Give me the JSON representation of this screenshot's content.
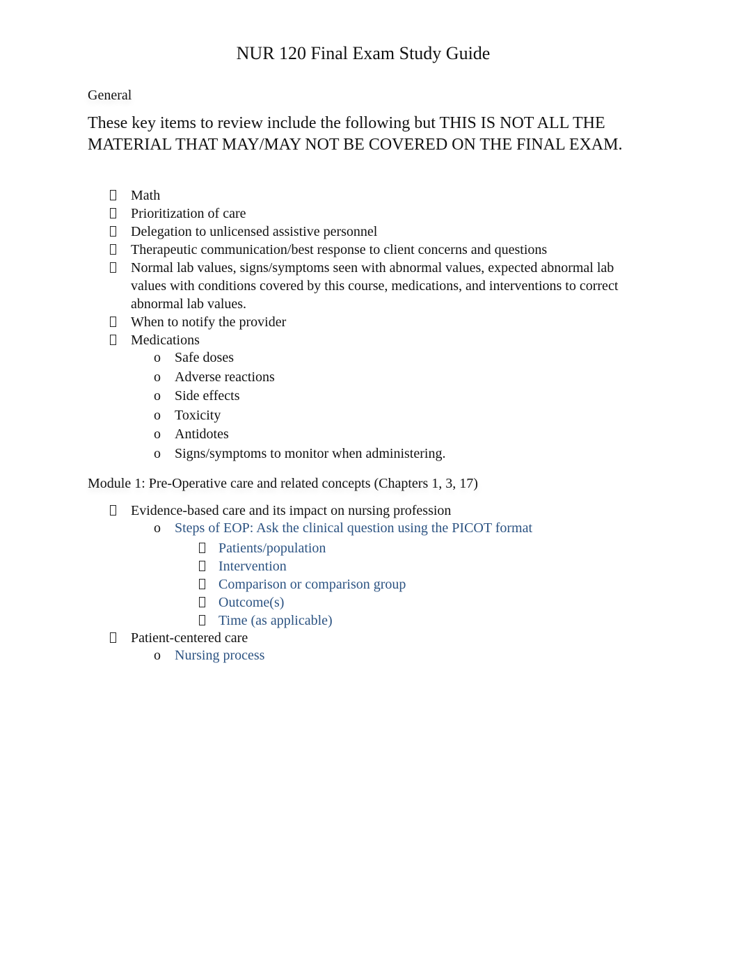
{
  "title": "NUR 120 Final Exam Study Guide",
  "general": {
    "heading": "General",
    "intro": "These key items to review include the following but THIS IS NOT ALL THE MATERIAL THAT MAY/MAY NOT BE COVERED ON THE FINAL EXAM.",
    "items": [
      "Math",
      "Prioritization of care",
      "Delegation to unlicensed assistive personnel",
      "Therapeutic communication/best response to client concerns and questions",
      "Normal lab values, signs/symptoms seen with abnormal values, expected abnormal lab values with conditions covered by this course, medications, and interventions to correct abnormal lab values.",
      "When to notify the provider",
      "Medications"
    ],
    "medication_subitems": [
      "Safe doses",
      "Adverse reactions",
      "Side effects",
      "Toxicity",
      "Antidotes",
      "Signs/symptoms to monitor when administering."
    ]
  },
  "module1": {
    "heading": "Module 1: Pre-Operative care and related concepts (Chapters 1, 3, 17)",
    "items": [
      {
        "label": "Evidence-based care and its impact on nursing profession",
        "sub": "Steps of EOP: Ask the clinical question using the PICOT format",
        "picot": [
          "Patients/population",
          "Intervention",
          "Comparison or comparison group",
          "Outcome(s)",
          "Time (as applicable)"
        ]
      },
      {
        "label": "Patient-centered care",
        "sub": "Nursing process"
      }
    ]
  },
  "bullets": {
    "level1": "box-bullet",
    "level2": "o",
    "level3": "box-bullet"
  },
  "colors": {
    "link_blue": "#2c5382",
    "text": "#111111"
  }
}
